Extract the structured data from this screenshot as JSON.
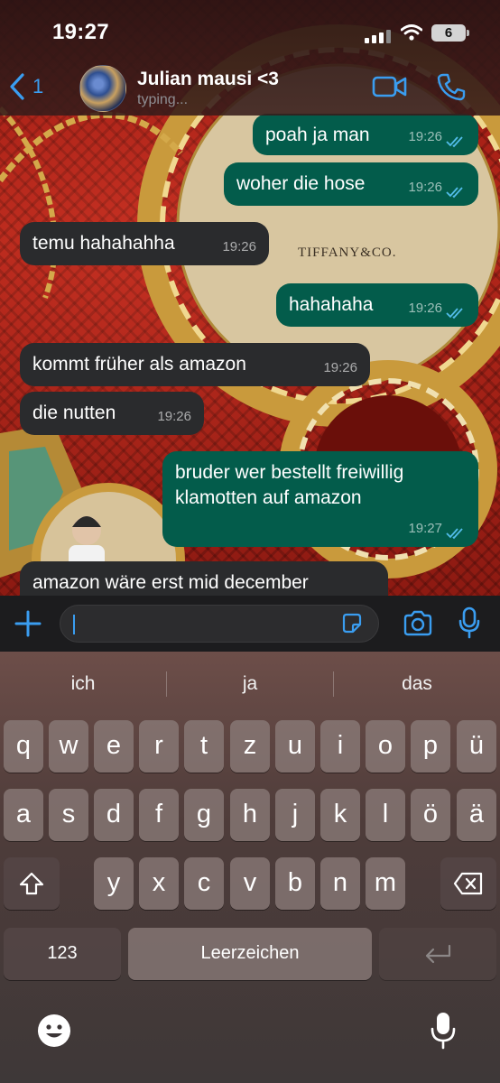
{
  "status_bar": {
    "time": "19:27",
    "battery": "6"
  },
  "header": {
    "back_count": "1",
    "contact_name": "Julian mausi <3",
    "contact_status": "typing..."
  },
  "messages": [
    {
      "direction": "out",
      "text": "poah ja man",
      "time": "19:26",
      "read": true
    },
    {
      "direction": "out",
      "text": "woher die hose",
      "time": "19:26",
      "read": true
    },
    {
      "direction": "in",
      "text": "temu hahahahha",
      "time": "19:26"
    },
    {
      "direction": "out",
      "text": "hahahaha",
      "time": "19:26",
      "read": true
    },
    {
      "direction": "in",
      "text": "kommt früher als amazon",
      "time": "19:26"
    },
    {
      "direction": "in",
      "text": "die nutten",
      "time": "19:26"
    },
    {
      "direction": "out",
      "text": "bruder wer bestellt freiwillig klamotten auf amazon",
      "time": "19:27",
      "read": true
    },
    {
      "direction": "in",
      "text": "amazon wäre erst mid december",
      "time": ""
    }
  ],
  "wallpaper": {
    "brand_text": "TIFFANY&CO."
  },
  "composer": {
    "input_value": ""
  },
  "keyboard": {
    "suggestions": [
      "ich",
      "ja",
      "das"
    ],
    "row1": [
      "q",
      "w",
      "e",
      "r",
      "t",
      "z",
      "u",
      "i",
      "o",
      "p",
      "ü"
    ],
    "row2": [
      "a",
      "s",
      "d",
      "f",
      "g",
      "h",
      "j",
      "k",
      "l",
      "ö",
      "ä"
    ],
    "row3": [
      "y",
      "x",
      "c",
      "v",
      "b",
      "n",
      "m"
    ],
    "numbers_key": "123",
    "space_key": "Leerzeichen"
  },
  "colors": {
    "accent": "#3a9df0",
    "outgoing_bubble": "#035c4b",
    "incoming_bubble": "#2a2b2d"
  }
}
